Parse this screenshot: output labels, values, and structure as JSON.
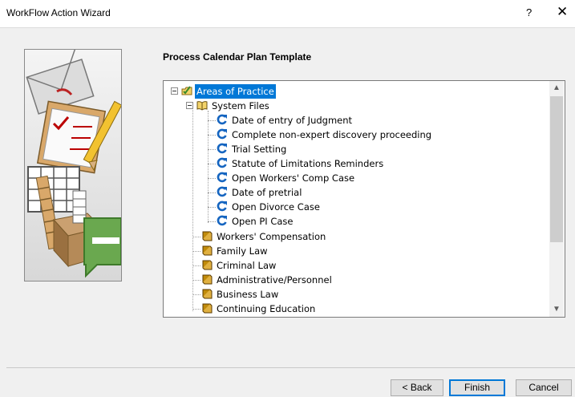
{
  "window": {
    "title": "WorkFlow Action Wizard",
    "help_label": "?",
    "close_label": "✕"
  },
  "page": {
    "heading": "Process Calendar Plan Template"
  },
  "tree": {
    "root": {
      "label": "Areas of Practice",
      "selected": true,
      "expanded": true
    },
    "system_files": {
      "label": "System Files",
      "expanded": true,
      "children": [
        "Date of entry of Judgment",
        "Complete non-expert discovery proceeding",
        "Trial Setting",
        "Statute of Limitations Reminders",
        "Open Workers' Comp Case",
        "Date of pretrial",
        "Open Divorce Case",
        "Open PI Case"
      ]
    },
    "folders": [
      "Workers' Compensation",
      "Family Law",
      "Criminal Law",
      "Administrative/Personnel",
      "Business Law",
      "Continuing Education"
    ],
    "icons": {
      "root": "open-folder-check-icon",
      "system_files": "open-book-icon",
      "plan": "refresh-calendar-icon",
      "folder": "closed-book-icon"
    }
  },
  "buttons": {
    "back": "< Back",
    "finish": "Finish",
    "cancel": "Cancel"
  },
  "colors": {
    "selection": "#0078d7",
    "plan_icon": "#1565c0",
    "book_icon": "#c08a0a"
  }
}
